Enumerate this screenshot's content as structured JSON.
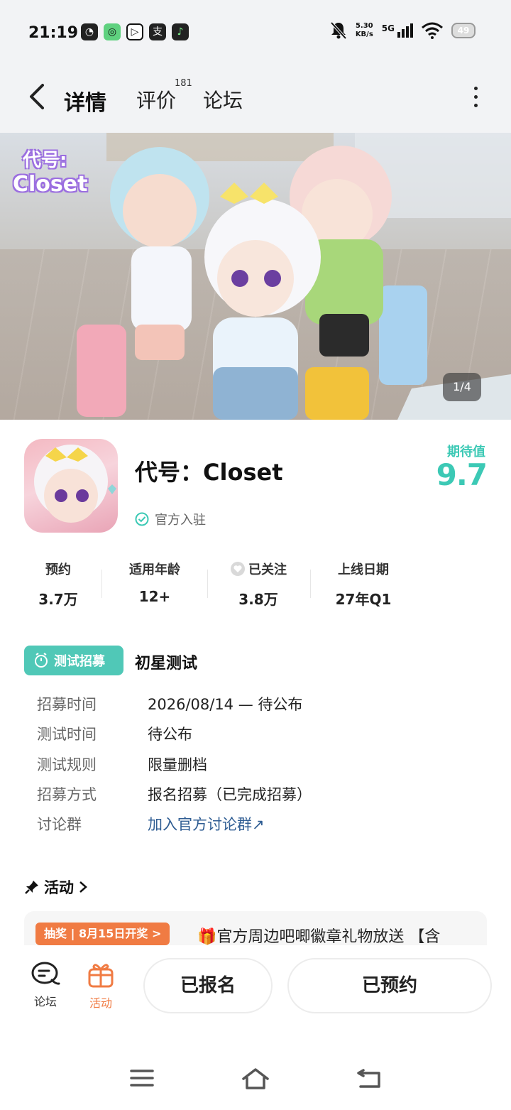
{
  "status_bar": {
    "time": "21:19",
    "network_speed_value": "5.30",
    "network_speed_unit": "KB/s",
    "network_type": "5G",
    "battery": "49",
    "app_icons": [
      "qq-icon",
      "camera-app-icon",
      "video-app-icon",
      "alipay-icon",
      "music-app-icon"
    ]
  },
  "nav": {
    "tabs": [
      {
        "label": "详情",
        "active": true
      },
      {
        "label": "评价",
        "badge": "181"
      },
      {
        "label": "论坛"
      }
    ]
  },
  "hero": {
    "logo_line1": "代号:",
    "logo_line2": "Closet",
    "counter": "1/4"
  },
  "game": {
    "title": "代号：Closet",
    "official_label": "官方入驻",
    "expect_label": "期待值",
    "expect_score": "9.7",
    "accent_color": "#3cc9b5"
  },
  "stats": [
    {
      "label": "预约",
      "value": "3.7万"
    },
    {
      "label": "适用年龄",
      "value": "12+"
    },
    {
      "label": "已关注",
      "value": "3.8万"
    },
    {
      "label": "上线日期",
      "value": "27年Q1"
    }
  ],
  "test": {
    "badge": "测试招募",
    "name": "初星测试",
    "rows": [
      {
        "key": "招募时间",
        "value": "2026/08/14 — 待公布"
      },
      {
        "key": "测试时间",
        "value": "待公布"
      },
      {
        "key": "测试规则",
        "value": "限量删档"
      },
      {
        "key": "招募方式",
        "value": "报名招募（已完成招募）"
      },
      {
        "key": "讨论群",
        "value": "加入官方讨论群↗"
      }
    ]
  },
  "activity": {
    "title": "活动",
    "tag": "抽奖 | 8月15日开奖 >",
    "text": "🎁官方周边吧唧徽章礼物放送 【含"
  },
  "action_bar": {
    "forum_label": "论坛",
    "activity_label": "活动",
    "signed_label": "已报名",
    "reserved_label": "已预约",
    "activity_color": "#f07b43"
  }
}
